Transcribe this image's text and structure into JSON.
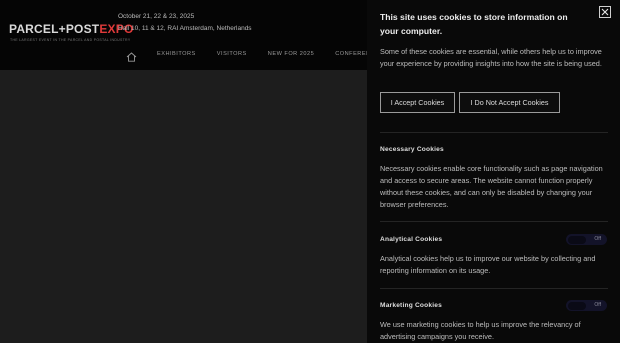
{
  "header": {
    "logo_main": "PARCEL+POST",
    "logo_expo": "EXPO",
    "logo_tagline": "THE LARGEST EVENT IN THE PARCEL AND POSTAL INDUSTRY",
    "dates": "October 21, 22 & 23, 2025",
    "venue": "Hall 10, 11 & 12, RAI Amsterdam, Netherlands"
  },
  "nav": {
    "home_icon": "home-icon",
    "items": [
      {
        "label": "EXHIBITORS"
      },
      {
        "label": "VISITORS"
      },
      {
        "label": "NEW FOR 2025"
      },
      {
        "label": "CONFERENCE"
      }
    ]
  },
  "cookie_panel": {
    "title": "This site uses cookies to store information on your computer.",
    "intro": "Some of these cookies are essential, while others help us to improve your experience by providing insights into how the site is being used.",
    "accept_label": "I Accept Cookies",
    "decline_label": "I Do Not Accept Cookies",
    "close_icon": "close-icon",
    "sections": [
      {
        "title": "Necessary Cookies",
        "desc": "Necessary cookies enable core functionality such as page navigation and access to secure areas. The website cannot function properly without these cookies, and can only be disabled by changing your browser preferences."
      },
      {
        "title": "Analytical Cookies",
        "desc": "Analytical cookies help us to improve our website by collecting and reporting information on its usage.",
        "toggle": "Off"
      },
      {
        "title": "Marketing Cookies",
        "desc": "We use marketing cookies to help us improve the relevancy of advertising campaigns you receive.",
        "toggle": "Off"
      }
    ]
  },
  "colors": {
    "header_bg": "#050505",
    "page_bg": "#1d1d1d",
    "panel_bg": "#090909",
    "accent": "#e03a3a"
  }
}
